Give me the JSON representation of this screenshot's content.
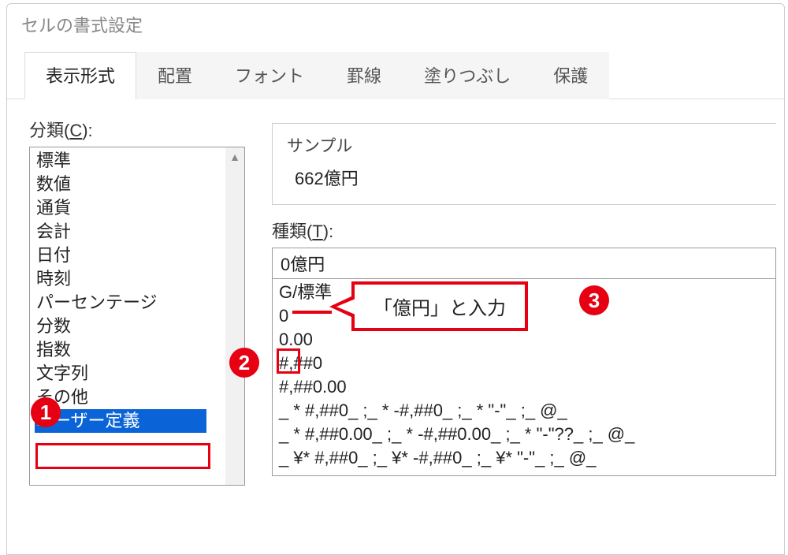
{
  "dialog": {
    "title": "セルの書式設定"
  },
  "tabs": [
    {
      "label": "表示形式",
      "active": true
    },
    {
      "label": "配置"
    },
    {
      "label": "フォント"
    },
    {
      "label": "罫線"
    },
    {
      "label": "塗りつぶし"
    },
    {
      "label": "保護"
    }
  ],
  "category": {
    "label_prefix": "分類(",
    "label_key": "C",
    "label_suffix": "):",
    "items": [
      "標準",
      "数値",
      "通貨",
      "会計",
      "日付",
      "時刻",
      "パーセンテージ",
      "分数",
      "指数",
      "文字列",
      "その他",
      "ユーザー定義"
    ],
    "selected_index": 11
  },
  "sample": {
    "label": "サンプル",
    "value": "662億円"
  },
  "type": {
    "label_prefix": "種類(",
    "label_key": "T",
    "label_suffix": "):",
    "value": "0億円",
    "formats": [
      "G/標準",
      "0",
      "0.00",
      "#,##0",
      "#,##0.00",
      "_ * #,##0_ ;_ * -#,##0_ ;_ * \"-\"_ ;_ @_",
      "_ * #,##0.00_ ;_ * -#,##0.00_ ;_ * \"-\"??_ ;_ @_",
      "_ ¥* #,##0_ ;_ ¥* -#,##0_ ;_ ¥* \"-\"_ ;_ @_"
    ]
  },
  "annotations": {
    "b1": "1",
    "b2": "2",
    "b3": "3",
    "callout": "「億円」と入力"
  }
}
